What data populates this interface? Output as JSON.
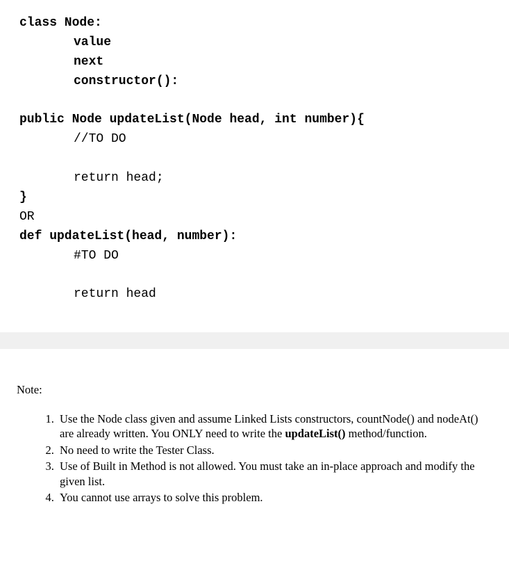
{
  "code": {
    "line1": "class Node:",
    "line2": "value",
    "line3": "next",
    "line4": "constructor():",
    "line5": "public Node updateList(Node head, int number){",
    "line6": "//TO DO",
    "line7": "return head;",
    "line8": "}",
    "line9": "OR",
    "line10": "def updateList(head, number):",
    "line11": "#TO DO",
    "line12": "return head"
  },
  "note": {
    "label": "Note:",
    "items": {
      "n1a": "Use the Node class given and assume Linked Lists constructors, countNode() and nodeAt() are already written. You ONLY need to write the ",
      "n1b": "updateList()",
      "n1c": " method/function.",
      "n2": "No need to write the Tester Class.",
      "n3": "Use of Built in Method is not allowed. You must take an in-place approach and modify the given list.",
      "n4": "You cannot use arrays to solve this problem."
    }
  }
}
